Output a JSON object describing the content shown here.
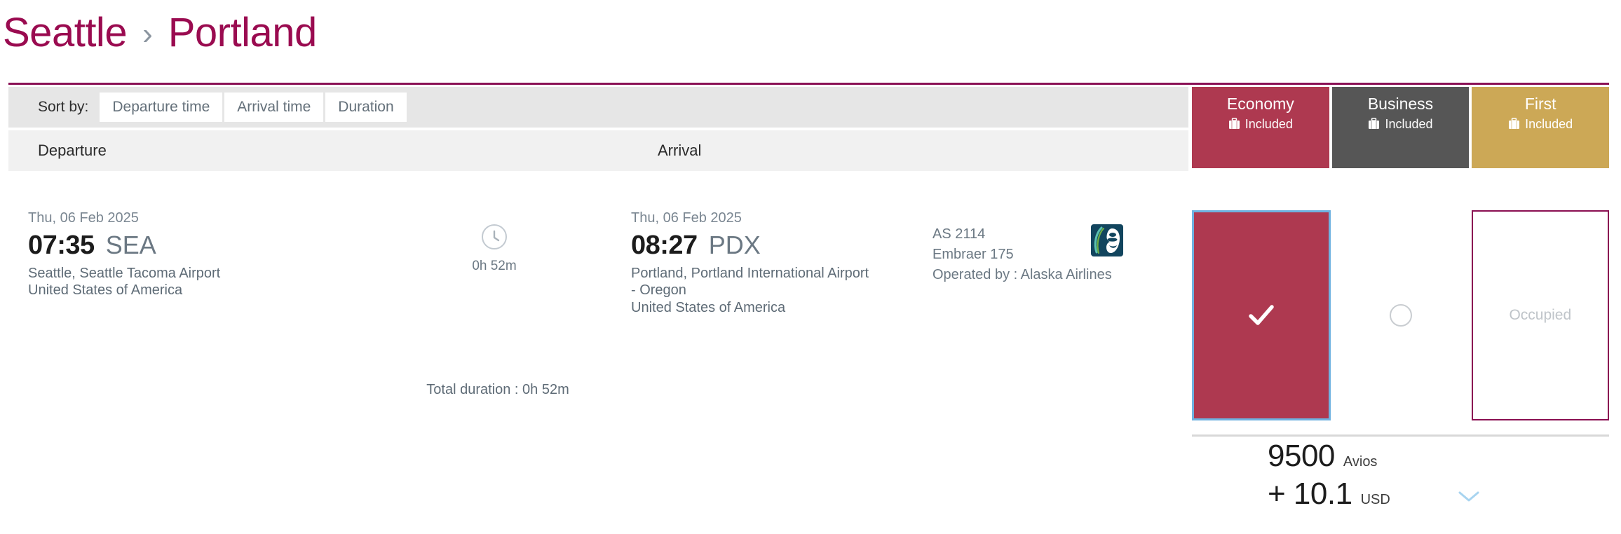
{
  "header": {
    "origin_city": "Seattle",
    "separator_icon": "chevron-right-icon",
    "destination_city": "Portland",
    "accent_color": "#9A0B50"
  },
  "sort": {
    "label": "Sort by:",
    "options": [
      {
        "label": "Departure time"
      },
      {
        "label": "Arrival time"
      },
      {
        "label": "Duration"
      }
    ]
  },
  "columns": {
    "departure": "Departure",
    "arrival": "Arrival"
  },
  "cabins": [
    {
      "name": "Economy",
      "baggage": "Included",
      "color": "#AE3950"
    },
    {
      "name": "Business",
      "baggage": "Included",
      "color": "#565656"
    },
    {
      "name": "First",
      "baggage": "Included",
      "color": "#CCA856"
    }
  ],
  "flight": {
    "departure": {
      "date": "Thu, 06 Feb 2025",
      "time": "07:35",
      "code": "SEA",
      "airport": "Seattle, Seattle Tacoma Airport",
      "country": "United States of America"
    },
    "arrival": {
      "date": "Thu, 06 Feb 2025",
      "time": "08:27",
      "code": "PDX",
      "airport": "Portland, Portland International Airport - Oregon",
      "country": "United States of America"
    },
    "leg_duration": "0h 52m",
    "total_duration": "Total duration : 0h 52m",
    "flight_number": "AS 2114",
    "aircraft": "Embraer 175",
    "operated_by": "Operated by : Alaska Airlines",
    "airline_logo": "alaska-airlines-logo"
  },
  "availability": [
    {
      "cabin": "Economy",
      "state": "selected",
      "label": ""
    },
    {
      "cabin": "Business",
      "state": "available",
      "label": ""
    },
    {
      "cabin": "First",
      "state": "occupied",
      "label": "Occupied"
    }
  ],
  "price": {
    "points_value": "9500",
    "points_unit": "Avios",
    "cash_value": "+ 10.1",
    "cash_unit": "USD",
    "expand_icon": "chevron-down-icon",
    "expand_color": "#A8D4F0"
  }
}
